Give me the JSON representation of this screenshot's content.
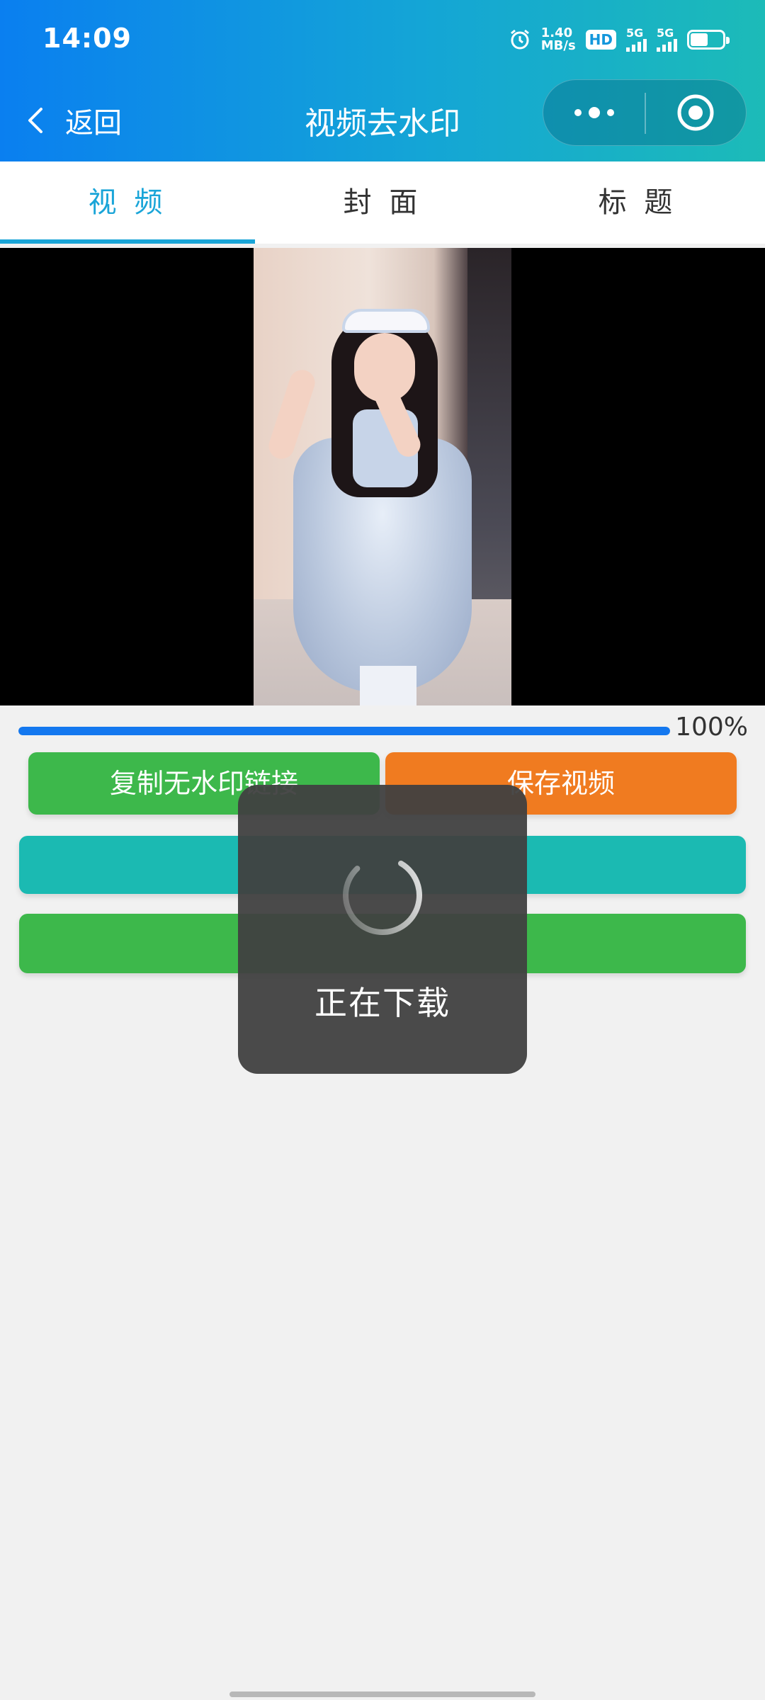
{
  "status_bar": {
    "time": "14:09",
    "net_speed_value": "1.40",
    "net_speed_unit": "MB/s",
    "hd_label": "HD",
    "sim1_label": "5G",
    "sim2_label": "5G",
    "battery_level": 0.55,
    "icons": [
      "alarm-icon",
      "hd-icon",
      "signal-icon",
      "signal-icon",
      "battery-icon"
    ]
  },
  "nav": {
    "back_label": "返回",
    "title": "视频去水印",
    "back_icon": "chevron-left-icon",
    "more_icon": "more-dots-icon",
    "close_icon": "target-icon"
  },
  "tabs": [
    {
      "label": "视 频",
      "active": true
    },
    {
      "label": "封 面",
      "active": false
    },
    {
      "label": "标 题",
      "active": false
    }
  ],
  "progress": {
    "value_percent": 100,
    "text": "100%"
  },
  "buttons": {
    "copy_link": "复制无水印链接",
    "save_video": "保存视频"
  },
  "toast": {
    "text": "正在下载",
    "icon": "loading-spinner-icon"
  },
  "colors": {
    "header_start": "#0a7ff0",
    "header_end": "#1cbbb8",
    "tab_active": "#1aa5d8",
    "progress": "#1478ef",
    "green": "#3db84b",
    "orange": "#f07b20",
    "teal": "#1bbab2"
  }
}
